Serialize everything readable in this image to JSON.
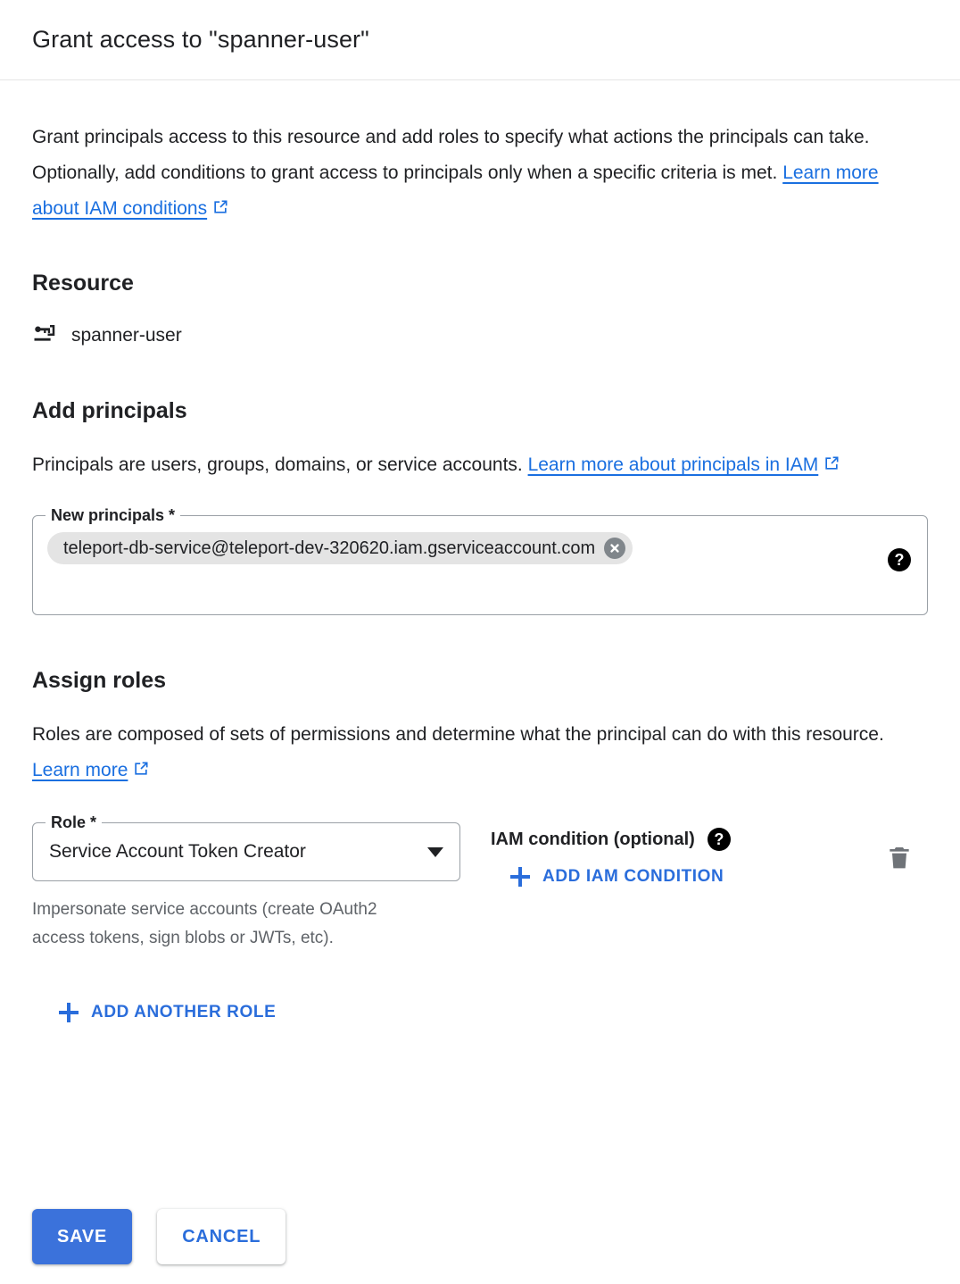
{
  "dialog": {
    "title": "Grant access to \"spanner-user\"",
    "intro_text_before_link": "Grant principals access to this resource and add roles to specify what actions the principals can take. Optionally, add conditions to grant access to principals only when a specific criteria is met. ",
    "intro_link_label": "Learn more about IAM conditions"
  },
  "resource": {
    "heading": "Resource",
    "icon": "service-account-key-icon",
    "name": "spanner-user"
  },
  "principals": {
    "heading": "Add principals",
    "desc_before_link": "Principals are users, groups, domains, or service accounts. ",
    "desc_link_label": "Learn more about principals in IAM",
    "field_label": "New principals *",
    "field_placeholder": "New principals",
    "chips": [
      {
        "label": "teleport-db-service@teleport-dev-320620.iam.gserviceaccount.com",
        "remove_icon": "close-icon"
      }
    ],
    "help_icon": "help-icon",
    "help_glyph": "?"
  },
  "roles": {
    "heading": "Assign roles",
    "desc_before_link": "Roles are composed of sets of permissions and determine what the principal can do with this resource. ",
    "desc_link_label": "Learn more",
    "rows": [
      {
        "role_label": "Role *",
        "role_value": "Service Account Token Creator",
        "role_helper": "Impersonate service accounts (create OAuth2 access tokens, sign blobs or JWTs, etc).",
        "condition_label": "IAM condition (optional)",
        "condition_help_glyph": "?",
        "add_condition_label": "ADD IAM CONDITION",
        "delete_icon": "trash-icon"
      }
    ],
    "add_another_role_label": "ADD ANOTHER ROLE"
  },
  "footer": {
    "save_label": "SAVE",
    "cancel_label": "CANCEL"
  },
  "colors": {
    "accent_blue": "#3b72db",
    "link_blue": "#1a6fe0",
    "text_primary": "#202124",
    "text_secondary": "#5f6368",
    "chip_background": "#e4e4e4",
    "border_gray": "#9aa0a6"
  }
}
